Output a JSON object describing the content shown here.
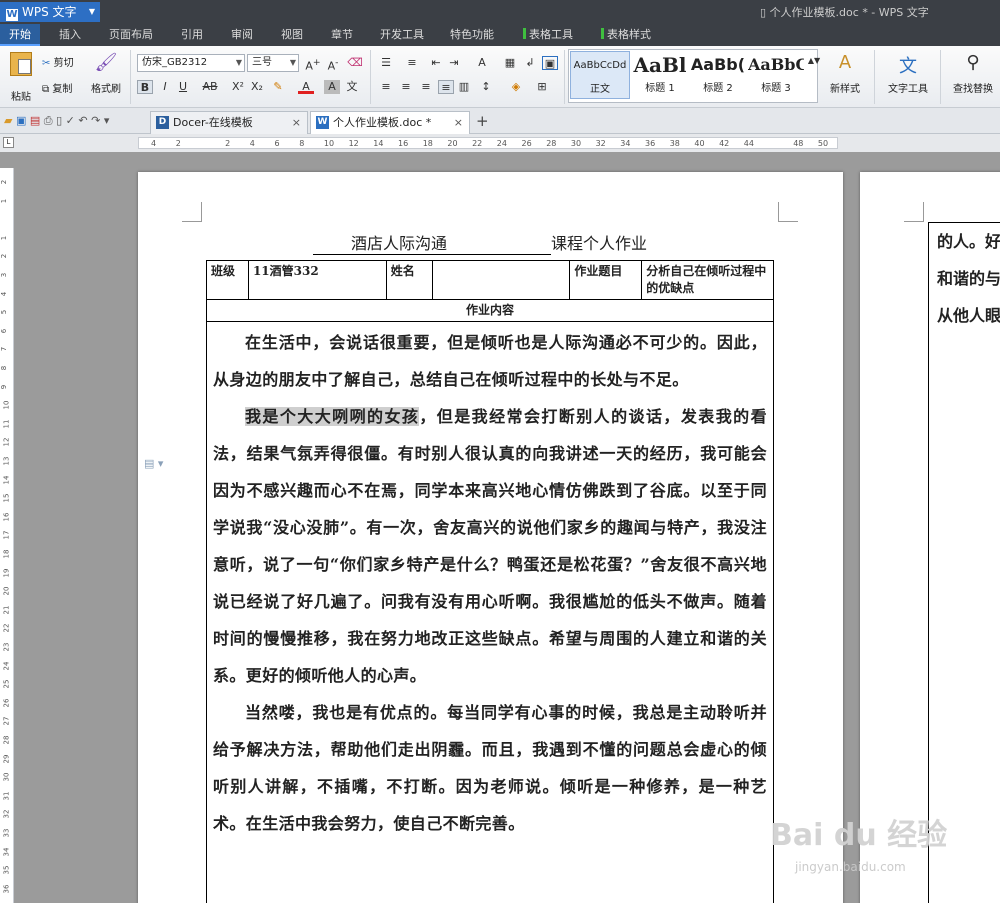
{
  "app": {
    "name": "WPS 文字",
    "window_title": "个人作业模板.doc * - WPS 文字"
  },
  "menu_tabs": [
    "开始",
    "插入",
    "页面布局",
    "引用",
    "审阅",
    "视图",
    "章节",
    "开发工具",
    "特色功能",
    "表格工具",
    "表格样式"
  ],
  "ribbon": {
    "paste": "粘贴",
    "cut": "剪切",
    "copy": "复制",
    "format_painter": "格式刷",
    "font_name": "仿宋_GB2312",
    "font_size": "三号",
    "styles": [
      {
        "preview": "AaBbCcDd",
        "label": "正文"
      },
      {
        "preview": "AaBl",
        "label": "标题 1"
      },
      {
        "preview": "AaBb(",
        "label": "标题 2"
      },
      {
        "preview": "AaBbC",
        "label": "标题 3"
      }
    ],
    "new_style": "新样式",
    "text_tools": "文字工具",
    "find_replace": "查找替换"
  },
  "doc_tabs": [
    {
      "label": "Docer-在线模板",
      "icon": "D"
    },
    {
      "label": "个人作业模板.doc *",
      "icon": "W"
    }
  ],
  "ruler_h": [
    "4",
    "2",
    "",
    "2",
    "4",
    "6",
    "8",
    "10",
    "12",
    "14",
    "16",
    "18",
    "20",
    "22",
    "24",
    "26",
    "28",
    "30",
    "32",
    "34",
    "36",
    "38",
    "40",
    "42",
    "44",
    "",
    "48",
    "50"
  ],
  "ruler_v": [
    "2",
    "1",
    "",
    "1",
    "2",
    "3",
    "4",
    "5",
    "6",
    "7",
    "8",
    "9",
    "10",
    "11",
    "12",
    "13",
    "14",
    "15",
    "16",
    "17",
    "18",
    "19",
    "20",
    "21",
    "22",
    "23",
    "24",
    "25",
    "26",
    "27",
    "28",
    "29",
    "30",
    "31",
    "32",
    "33",
    "34",
    "35",
    "36"
  ],
  "document": {
    "title_prefix": "酒店人际沟通",
    "title_suffix": "课程个人作业",
    "table": {
      "class_label": "班级",
      "class_value": "11酒管332",
      "name_label": "姓名",
      "name_value": "",
      "topic_label": "作业题目",
      "topic_value": "分析自己在倾听过程中的优缺点",
      "content_label": "作业内容"
    },
    "p1": "在生活中，会说话很重要，但是倾听也是人际沟通必不可少的。因此，从身边的朋友中了解自己，总结自己在倾听过程中的长处与不足。",
    "p2_highlight": "我是个大大咧咧的女孩",
    "p2_rest": "，但是我经常会打断别人的谈话，发表我的看法，结果气氛弄得很僵。有时别人很认真的向我讲述一天的经历，我可能会因为不感兴趣而心不在焉，同学本来高兴地心情仿佛跌到了谷底。以至于同学说我“没心没肺”。有一次，舍友高兴的说他们家乡的趣闻与特产，我没注意听，说了一句“你们家乡特产是什么？鸭蛋还是松花蛋？”舍友很不高兴地说已经说了好几遍了。问我有没有用心听啊。我很尴尬的低头不做声。随着时间的慢慢推移，我在努力地改正这些缺点。希望与周围的人建立和谐的关系。更好的倾听他人的心声。",
    "p3": "当然喽，我也是有优点的。每当同学有心事的时候，我总是主动聆听并给予解决方法，帮助他们走出阴霾。而且，我遇到不懂的问题总会虚心的倾听别人讲解，不插嘴，不打断。因为老师说。倾听是一种修养，是一种艺术。在生活中我会努力，使自己不断完善。",
    "page2_lines": [
      "的人。好",
      "和谐的与",
      "从他人眼"
    ]
  },
  "watermark": {
    "big": "Bai du 经验",
    "small": "jingyan.baidu.com"
  }
}
